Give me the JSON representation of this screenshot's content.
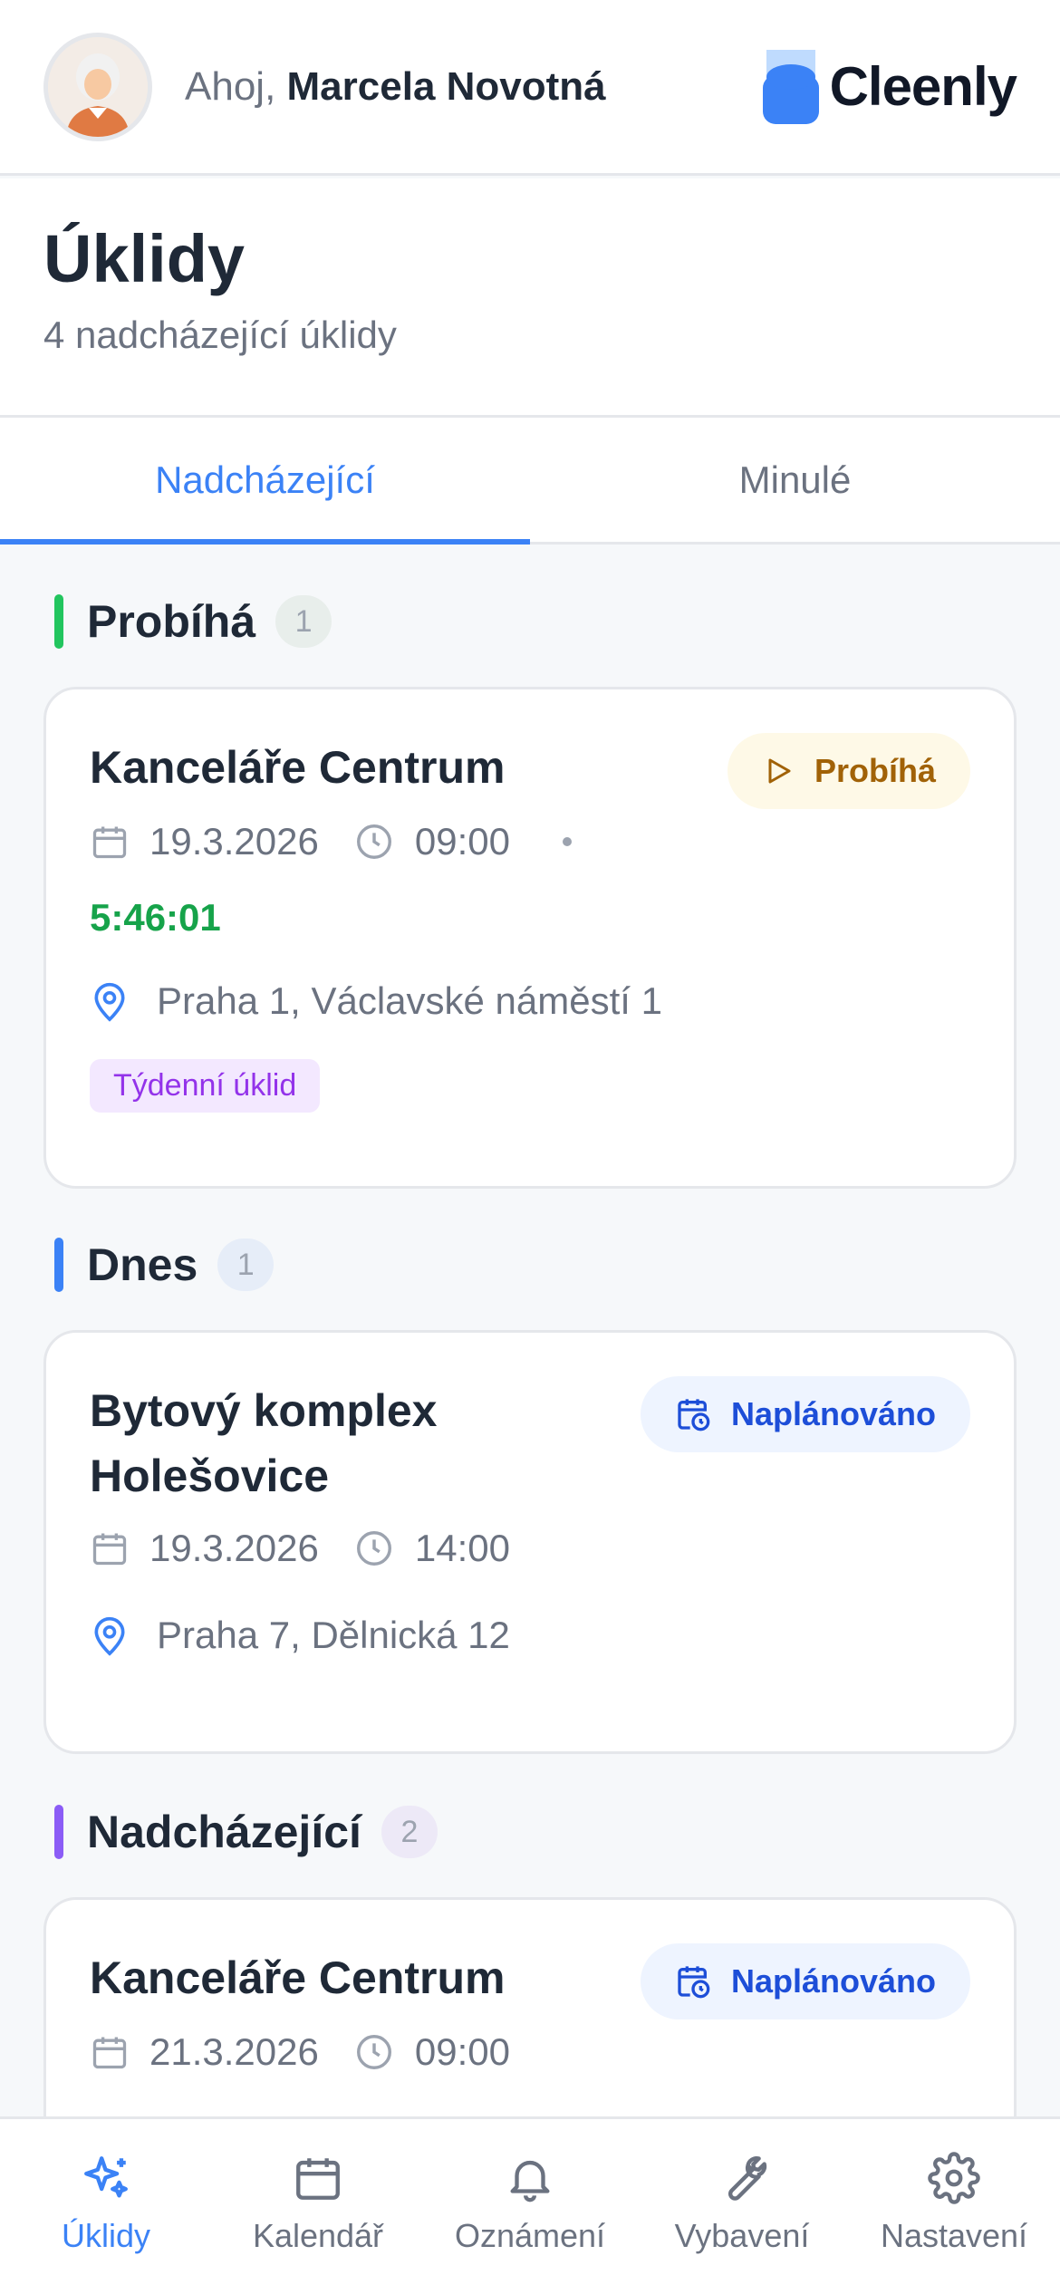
{
  "header": {
    "greeting_prefix": "Ahoj,",
    "user_name": "Marcela Novotná",
    "brand_name": "Cleenly"
  },
  "page": {
    "title": "Úklidy",
    "subtitle": "4 nadcházející úklidy"
  },
  "tabs": [
    {
      "label": "Nadcházející",
      "active": true
    },
    {
      "label": "Minulé",
      "active": false
    }
  ],
  "sections": {
    "running": {
      "title": "Probíhá",
      "count": "1",
      "color": "#22c55e",
      "card": {
        "title": "Kanceláře Centrum",
        "badge": "Probíhá",
        "date": "19.3.2026",
        "time": "09:00",
        "timer": "5:46:01",
        "address": "Praha 1, Václavské náměstí 1",
        "tag": "Týdenní úklid"
      }
    },
    "today": {
      "title": "Dnes",
      "count": "1",
      "color": "#3b82f6",
      "card": {
        "title_line1": "Bytový komplex",
        "title_line2": "Holešovice",
        "badge": "Naplánováno",
        "date": "19.3.2026",
        "time": "14:00",
        "address": "Praha 7, Dělnická 12"
      }
    },
    "upcoming": {
      "title": "Nadcházející",
      "count": "2",
      "color": "#8b5cf6",
      "card": {
        "title": "Kanceláře Centrum",
        "badge": "Naplánováno",
        "date": "21.3.2026",
        "time": "09:00"
      }
    }
  },
  "nav": [
    {
      "label": "Úklidy",
      "icon": "sparkles-icon",
      "active": true
    },
    {
      "label": "Kalendář",
      "icon": "calendar-icon",
      "active": false
    },
    {
      "label": "Oznámení",
      "icon": "bell-icon",
      "active": false
    },
    {
      "label": "Vybavení",
      "icon": "wrench-icon",
      "active": false
    },
    {
      "label": "Nastavení",
      "icon": "gear-icon",
      "active": false
    }
  ],
  "colors": {
    "accent": "#3b82f6",
    "running_badge_bg": "#fef9e7",
    "running_badge_text": "#a16207",
    "planned_badge_bg": "#eef4ff",
    "planned_badge_text": "#1d4ed8",
    "timer": "#16a34a",
    "tag_bg": "#f3e8ff",
    "tag_text": "#9333ea"
  }
}
